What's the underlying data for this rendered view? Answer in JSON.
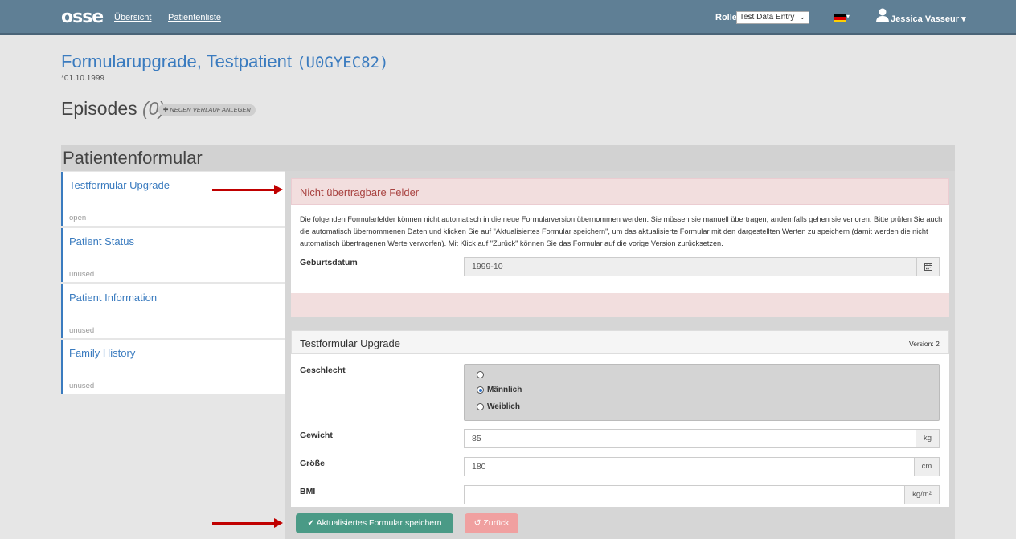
{
  "navbar": {
    "logo": "osse",
    "links": [
      "Übersicht",
      "Patientenliste"
    ],
    "role_label": "Rolle",
    "role_value": "Test Data Entry",
    "user_name": "Jessica Vasseur"
  },
  "header": {
    "title": "Formularupgrade, Testpatient",
    "patient_code": "(U0GYEC82)",
    "birthdate": "*01.10.1999"
  },
  "episodes": {
    "title": "Episodes",
    "count": "(0)",
    "new_button": "NEUEN VERLAUF ANLEGEN"
  },
  "patient_form": {
    "title": "Patientenformular"
  },
  "sidebar": {
    "items": [
      {
        "label": "Testformular Upgrade",
        "status": "open"
      },
      {
        "label": "Patient Status",
        "status": "unused"
      },
      {
        "label": "Patient Information",
        "status": "unused"
      },
      {
        "label": "Family History",
        "status": "unused"
      }
    ]
  },
  "error_panel": {
    "title": "Nicht übertragbare Felder",
    "description": "Die folgenden Formularfelder können nicht automatisch in die neue Formularversion übernommen werden. Sie müssen sie manuell übertragen, andernfalls gehen sie verloren. Bitte prüfen Sie auch die automatisch übernommenen Daten und klicken Sie auf \"Aktualisiertes Formular speichern\", um das aktualisierte Formular mit den dargestellten Werten zu speichern (damit werden die nicht automatisch übertragenen Werte verworfen). Mit Klick auf \"Zurück\" können Sie das Formular auf die vorige Version zurücksetzen.",
    "field_label": "Geburtsdatum",
    "field_value": "1999-10"
  },
  "form": {
    "title": "Testformular Upgrade",
    "version": "Version: 2",
    "gender_label": "Geschlecht",
    "gender_options": [
      "",
      "Männlich",
      "Weiblich"
    ],
    "gender_selected": "Männlich",
    "weight_label": "Gewicht",
    "weight_value": "85",
    "weight_unit": "kg",
    "height_label": "Größe",
    "height_value": "180",
    "height_unit": "cm",
    "bmi_label": "BMI",
    "bmi_value": "",
    "bmi_unit": "kg/m²"
  },
  "buttons": {
    "save": "Aktualisiertes Formular speichern",
    "back": "Zurück"
  },
  "colors": {
    "navbar": "#5f7f95",
    "link": "#3a7bbf",
    "save_button": "#4a9a86",
    "back_button": "#f0a0a0",
    "error_bg": "#f2dede",
    "arrow": "#c00000"
  }
}
